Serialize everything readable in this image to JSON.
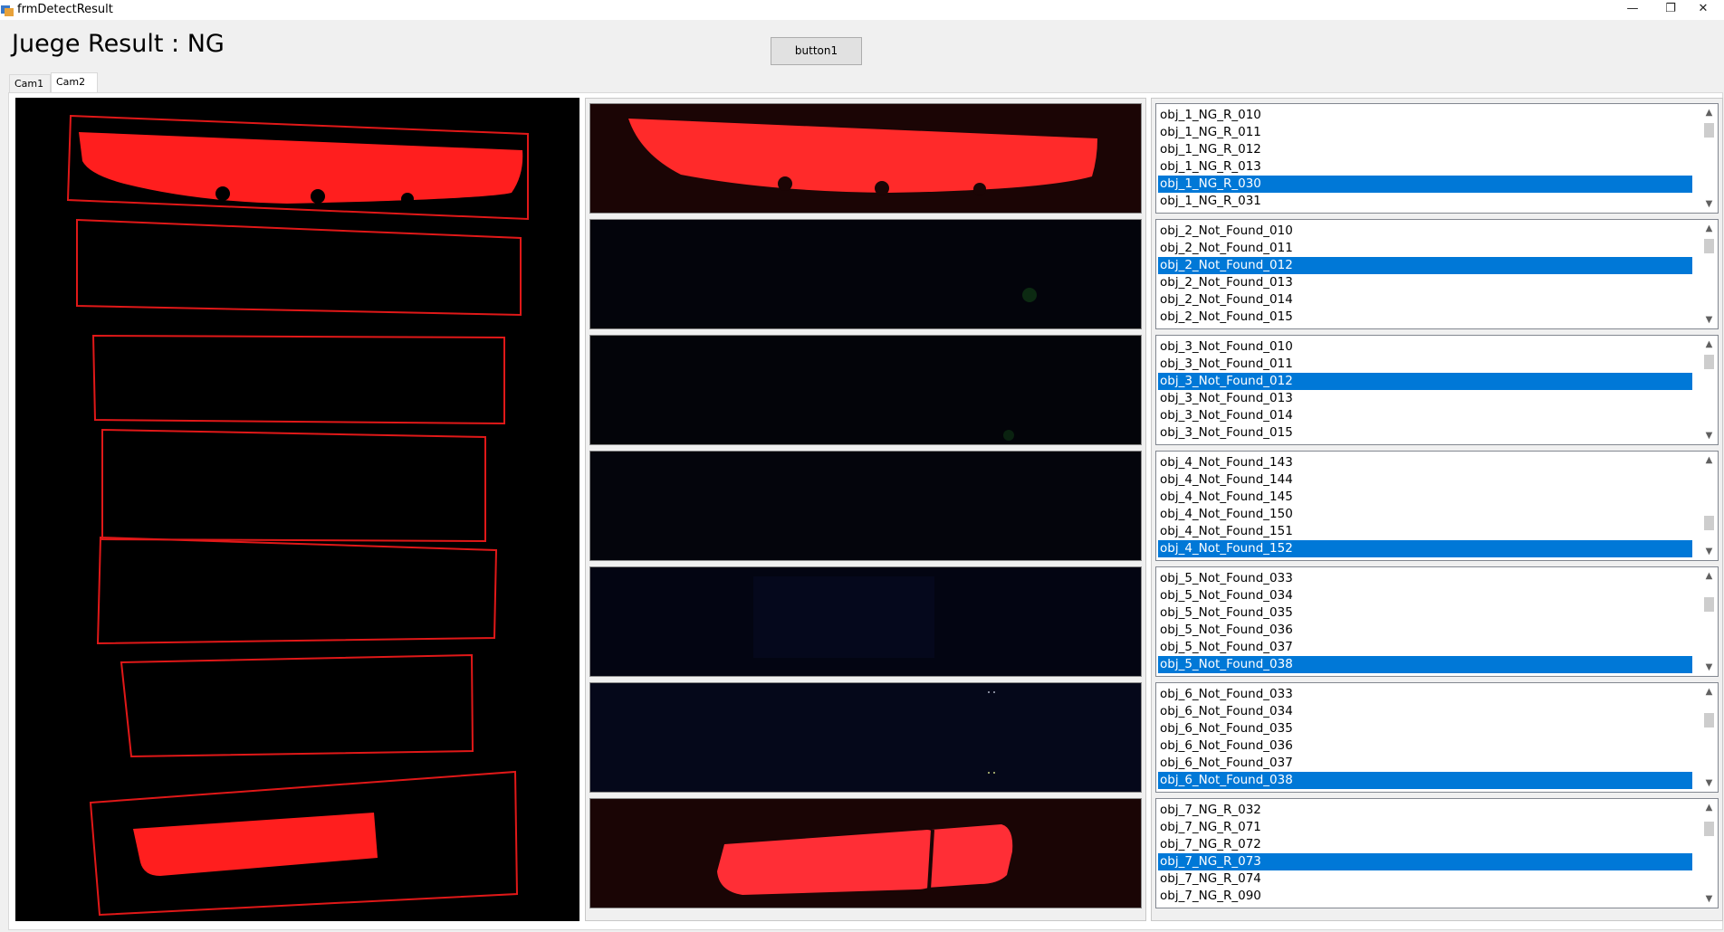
{
  "window": {
    "title": "frmDetectResult",
    "minimize_glyph": "—",
    "restore_glyph": "❐",
    "close_glyph": "✕"
  },
  "header": {
    "judge_text": "Juege Result : NG",
    "button_label": "button1"
  },
  "tabs": [
    {
      "label": "Cam1",
      "selected": false
    },
    {
      "label": "Cam2",
      "selected": true
    }
  ],
  "thumbnails": [
    {
      "name": "obj-1",
      "content": "red-lamp"
    },
    {
      "name": "obj-2",
      "content": "dark"
    },
    {
      "name": "obj-3",
      "content": "dark"
    },
    {
      "name": "obj-4",
      "content": "dark"
    },
    {
      "name": "obj-5",
      "content": "dark"
    },
    {
      "name": "obj-6",
      "content": "dark"
    },
    {
      "name": "obj-7",
      "content": "red-lamp"
    }
  ],
  "result_lists": [
    {
      "items": [
        "obj_1_NG_R_010",
        "obj_1_NG_R_011",
        "obj_1_NG_R_012",
        "obj_1_NG_R_013",
        "obj_1_NG_R_030",
        "obj_1_NG_R_031"
      ],
      "selected_index": 4
    },
    {
      "items": [
        "obj_2_Not_Found_010",
        "obj_2_Not_Found_011",
        "obj_2_Not_Found_012",
        "obj_2_Not_Found_013",
        "obj_2_Not_Found_014",
        "obj_2_Not_Found_015"
      ],
      "selected_index": 2
    },
    {
      "items": [
        "obj_3_Not_Found_010",
        "obj_3_Not_Found_011",
        "obj_3_Not_Found_012",
        "obj_3_Not_Found_013",
        "obj_3_Not_Found_014",
        "obj_3_Not_Found_015"
      ],
      "selected_index": 2
    },
    {
      "items": [
        "obj_4_Not_Found_143",
        "obj_4_Not_Found_144",
        "obj_4_Not_Found_145",
        "obj_4_Not_Found_150",
        "obj_4_Not_Found_151",
        "obj_4_Not_Found_152"
      ],
      "selected_index": 5
    },
    {
      "items": [
        "obj_5_Not_Found_033",
        "obj_5_Not_Found_034",
        "obj_5_Not_Found_035",
        "obj_5_Not_Found_036",
        "obj_5_Not_Found_037",
        "obj_5_Not_Found_038"
      ],
      "selected_index": 5
    },
    {
      "items": [
        "obj_6_Not_Found_033",
        "obj_6_Not_Found_034",
        "obj_6_Not_Found_035",
        "obj_6_Not_Found_036",
        "obj_6_Not_Found_037",
        "obj_6_Not_Found_038"
      ],
      "selected_index": 5
    },
    {
      "items": [
        "obj_7_NG_R_032",
        "obj_7_NG_R_071",
        "obj_7_NG_R_072",
        "obj_7_NG_R_073",
        "obj_7_NG_R_074",
        "obj_7_NG_R_090"
      ],
      "selected_index": 3
    }
  ],
  "colors": {
    "selection": "#0078d7",
    "detect_box": "#e01818",
    "lamp_red": "#ff1e1e"
  }
}
